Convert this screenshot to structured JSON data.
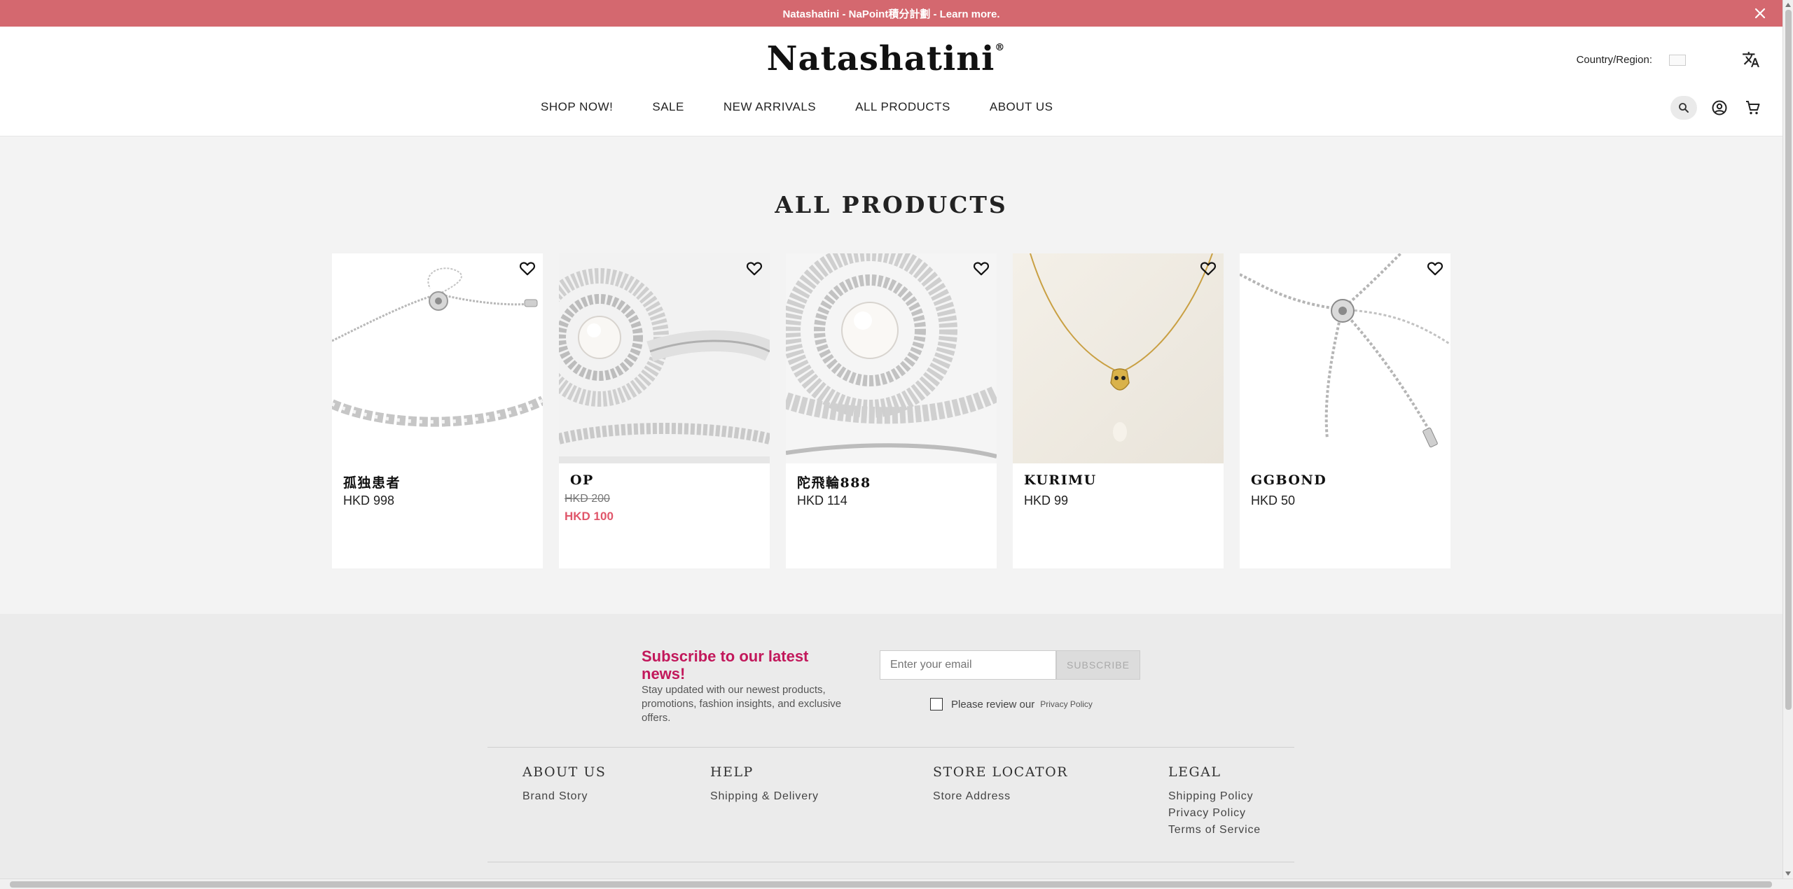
{
  "announcement": {
    "text": "Natashatini - NaPoint積分計劃 - Learn more."
  },
  "header": {
    "logo": "Natashatini",
    "logo_mark": "®",
    "country_label": "Country/Region:",
    "nav": [
      "SHOP NOW!",
      "SALE",
      "NEW ARRIVALS",
      "ALL PRODUCTS",
      "ABOUT US"
    ]
  },
  "main": {
    "title": "ALL PRODUCTS",
    "products": [
      {
        "name": "孤独患者",
        "price": "HKD 998"
      },
      {
        "name": "OP",
        "old_price": "HKD 200",
        "sale_price": "HKD 100"
      },
      {
        "name": "陀飛輪888",
        "price": "HKD 114"
      },
      {
        "name": "KURIMU",
        "price": "HKD 99"
      },
      {
        "name": "GGBOND",
        "price": "HKD 50"
      }
    ]
  },
  "subscribe": {
    "heading": "Subscribe to our latest news!",
    "text": "Stay updated with our newest products, promotions, fashion insights, and exclusive offers.",
    "email_placeholder": "Enter your email",
    "button": "SUBSCRIBE",
    "consent": "Please review our",
    "consent_link": "Privacy Policy"
  },
  "footer": {
    "about": {
      "title": "ABOUT US",
      "links": [
        "Brand Story"
      ]
    },
    "help": {
      "title": "HELP",
      "links": [
        "Shipping & Delivery"
      ]
    },
    "store": {
      "title": "STORE LOCATOR",
      "links": [
        "Store Address"
      ]
    },
    "legal": {
      "title": "LEGAL",
      "links": [
        "Shipping Policy",
        "Privacy Policy",
        "Terms of Service"
      ]
    }
  },
  "colors": {
    "announcement_bg": "#d4686f",
    "sale_price": "#e0566a",
    "subscribe_heading": "#c2185b"
  }
}
